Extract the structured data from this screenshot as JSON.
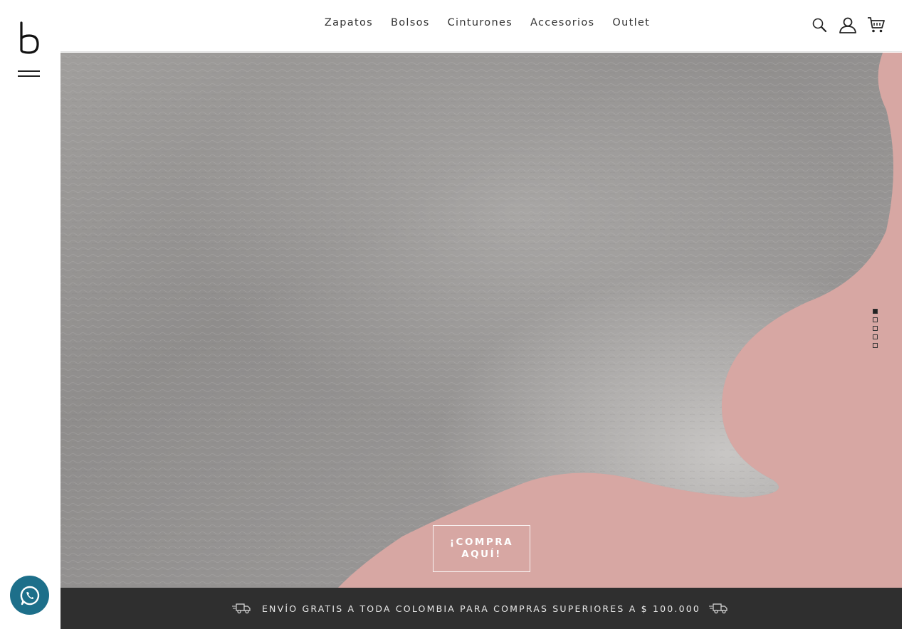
{
  "brand": {
    "logo_icon": "b-logo-icon"
  },
  "nav": {
    "items": [
      {
        "label": "Zapatos"
      },
      {
        "label": "Bolsos"
      },
      {
        "label": "Cinturones"
      },
      {
        "label": "Accesorios"
      },
      {
        "label": "Outlet"
      }
    ]
  },
  "header_icons": [
    "search-icon",
    "user-icon",
    "cart-icon"
  ],
  "hero": {
    "cta_label": "¡COMPRA AQUÍ!",
    "slides_total": 5,
    "active_slide": 1
  },
  "shipping_bar": {
    "text": "ENVÍO GRATIS A TODA COLOMBIA PARA COMPRAS SUPERIORES A $ 100.000",
    "icon": "truck-icon"
  },
  "floating": {
    "whatsapp_icon": "whatsapp-icon"
  },
  "colors": {
    "hero_pink": "#d7a7a3",
    "leather_gray": "#9c9a98",
    "ship_bar": "#2f2f2f",
    "text_dark": "#333333"
  }
}
